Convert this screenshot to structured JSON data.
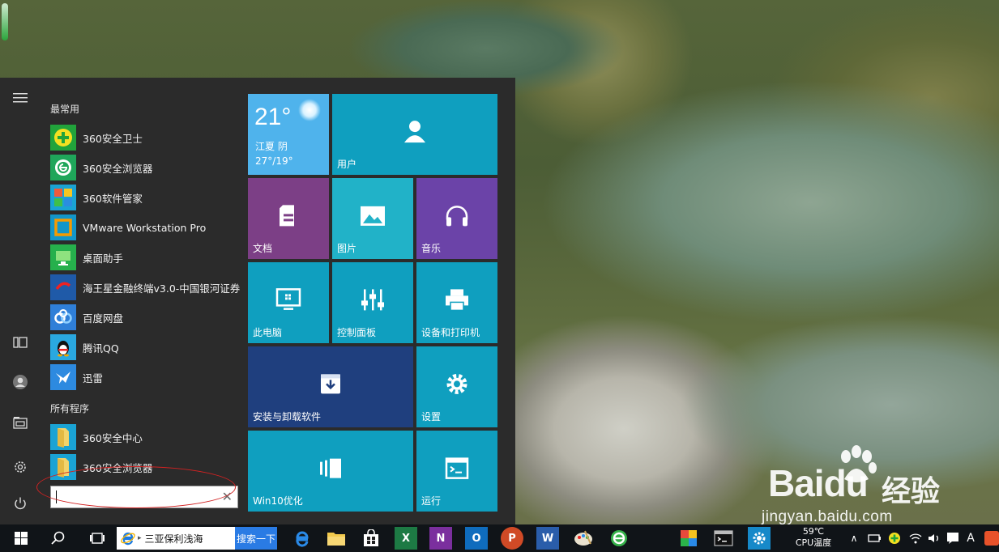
{
  "start_menu": {
    "most_used_label": "最常用",
    "all_programs_label": "所有程序",
    "most_used": [
      {
        "label": "360安全卫士",
        "icon": "360-security-guard-icon"
      },
      {
        "label": "360安全浏览器",
        "icon": "360-browser-icon"
      },
      {
        "label": "360软件管家",
        "icon": "360-software-manager-icon"
      },
      {
        "label": "VMware Workstation Pro",
        "icon": "vmware-icon"
      },
      {
        "label": "桌面助手",
        "icon": "desktop-assistant-icon"
      },
      {
        "label": "海王星金融终端v3.0-中国银河证券",
        "icon": "neptune-finance-icon"
      },
      {
        "label": "百度网盘",
        "icon": "baidu-netdisk-icon"
      },
      {
        "label": "腾讯QQ",
        "icon": "qq-penguin-icon"
      },
      {
        "label": "迅雷",
        "icon": "xunlei-bird-icon"
      }
    ],
    "all_programs": [
      {
        "label": "360安全中心",
        "icon": "folder-icon"
      },
      {
        "label": "360安全浏览器",
        "icon": "folder-icon"
      }
    ],
    "search": {
      "value": "",
      "clear_glyph": "✕"
    }
  },
  "tiles": {
    "weather": {
      "temp": "21°",
      "city": "江夏 阴",
      "range": "27°/19°"
    },
    "user": "用户",
    "documents": "文档",
    "pictures": "图片",
    "music": "音乐",
    "this_pc": "此电脑",
    "control_panel": "控制面板",
    "devices_printers": "设备和打印机",
    "install_uninstall": "安装与卸载软件",
    "settings": "设置",
    "win10_optimize": "Win10优化",
    "run": "运行"
  },
  "taskbar": {
    "address_text": "三亚保利浅海",
    "search_button": "搜索一下",
    "cpu_temp_value": "59℃",
    "cpu_temp_label": "CPU温度",
    "ime_label": "A",
    "apps": [
      "edge",
      "file-explorer",
      "store",
      "excel",
      "onenote",
      "outlook",
      "powerpoint",
      "word",
      "paint",
      "360-browser",
      "sticky-app",
      "terminal",
      "settings"
    ]
  },
  "watermark": {
    "brand": "Baidu",
    "brand_cn": "经验",
    "url": "jingyan.baidu.com"
  },
  "colors": {
    "menu_bg": "#2b2b2b",
    "tile_cyan": "#0f9fbf",
    "tile_purple": "#7c3f86",
    "tile_teal": "#21b2c8",
    "tile_violet": "#6b43a8",
    "tile_navy": "#1f3f7e",
    "tile_weather": "#4fb3ec",
    "annotation_red": "#d22222"
  }
}
